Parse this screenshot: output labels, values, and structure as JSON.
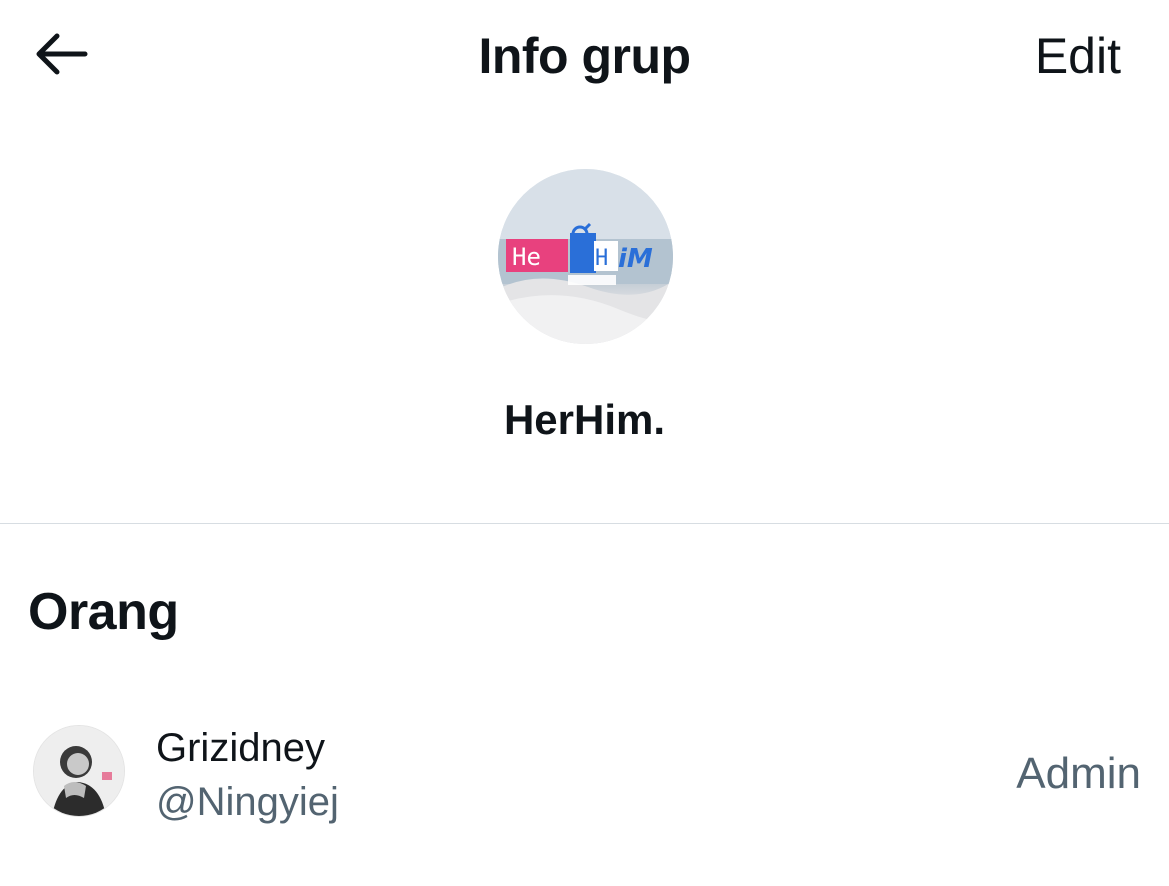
{
  "header": {
    "title": "Info grup",
    "edit_label": "Edit",
    "back_icon": "arrow-left-icon"
  },
  "group": {
    "name": "HerHim.",
    "avatar_logo_text_left": "He",
    "avatar_logo_text_right": "HiM",
    "avatar_colors": {
      "pink": "#e8417e",
      "blue": "#2a6fd8"
    }
  },
  "people": {
    "title": "Orang",
    "members": [
      {
        "name": "Grizidney",
        "handle": "@Ningyiej",
        "role": "Admin"
      }
    ]
  },
  "colors": {
    "text_primary": "#0f1419",
    "text_secondary": "#536471",
    "divider": "#d7dde2"
  }
}
